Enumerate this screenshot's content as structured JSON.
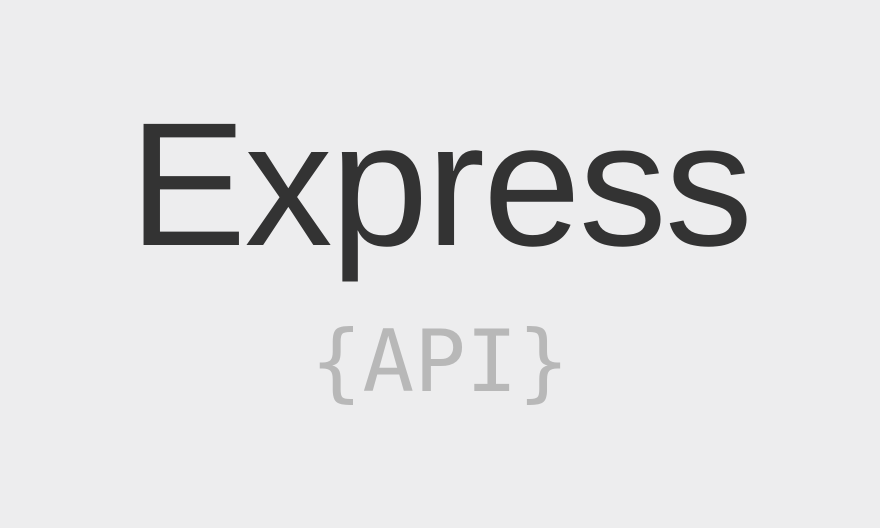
{
  "logo": {
    "title": "Express",
    "subtitle": "{API}"
  },
  "colors": {
    "background": "#ededee",
    "title": "#333333",
    "subtitle": "#b8b8b8"
  }
}
